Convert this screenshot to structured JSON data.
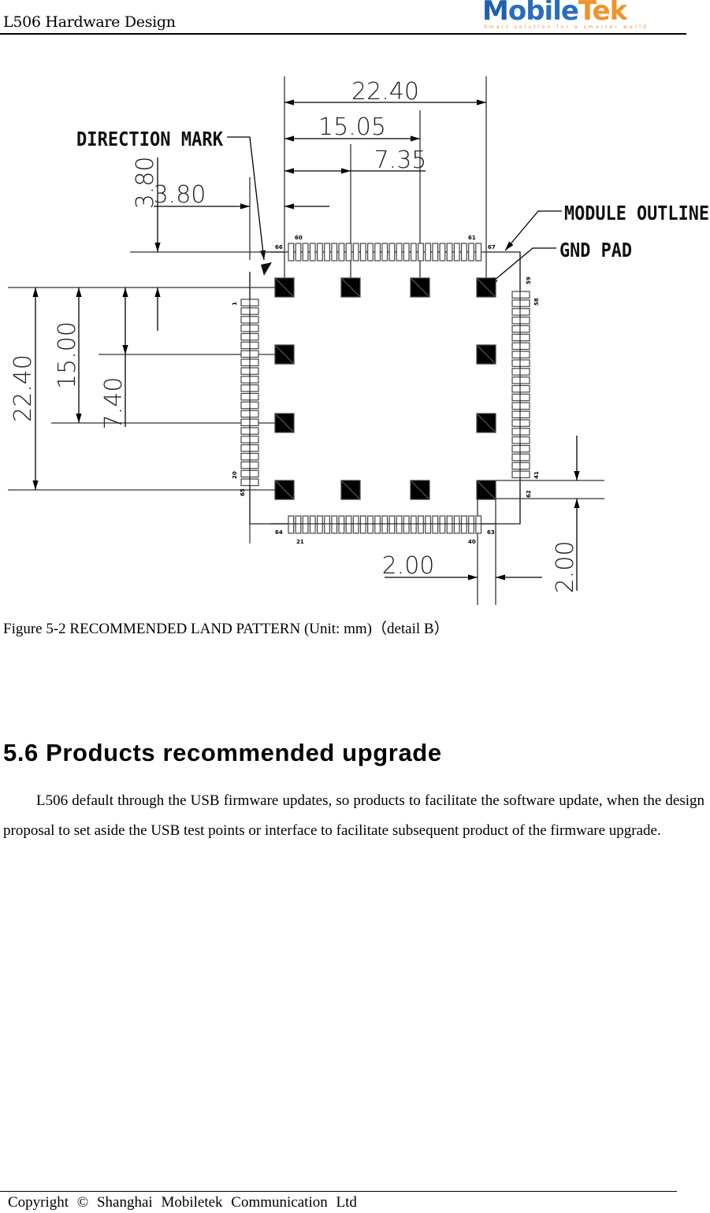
{
  "header": {
    "doc_title": "L506 Hardware Design",
    "logo": {
      "brand_prefix": "M",
      "brand_mid": "obile",
      "brand_suffix": "Tek",
      "tagline": "Smart solution for a smarter world",
      "colors": {
        "blue": "#1f5fb0",
        "orange": "#f0922b"
      }
    }
  },
  "figure": {
    "labels": {
      "direction_mark": "DIRECTION MARK",
      "module_outline": "MODULE OUTLINE",
      "gnd_pad": "GND PAD"
    },
    "dimensions": {
      "top_width": "22.40",
      "top_15": "15.05",
      "top_7": "7.35",
      "mark_h": "3.80",
      "mark_v": "3.80",
      "left_height": "22.40",
      "left_15": "15.00",
      "left_7": "7.40",
      "bottom_gap_h": "2.00",
      "right_gap_v": "2.00"
    },
    "pin_labels": {
      "top_left": "66",
      "top_second": "60",
      "top_right_inner": "61",
      "top_right": "67",
      "left_top": "1",
      "left_bottom": "20",
      "left_corner": "65",
      "bottom_left": "64",
      "bottom_first": "21",
      "bottom_last": "40",
      "bottom_right": "63",
      "right_top": "59",
      "right_second": "58",
      "right_bottom": "41",
      "right_corner": "62"
    },
    "pad_counts": {
      "top_row": 27,
      "bottom_row": 27,
      "left_column": 22,
      "right_column": 22,
      "gnd_pads": 12
    },
    "caption": "Figure 5-2 RECOMMENDED LAND PATTERN (Unit: mm)（detail B）"
  },
  "section": {
    "title": "5.6 Products recommended upgrade",
    "paragraph": "L506 default through the USB firmware updates, so products to facilitate the software update, when the design proposal to set aside the USB test points or interface to facilitate subsequent product of the firmware upgrade."
  },
  "footer": {
    "copyright": "Copyright © Shanghai Mobiletek Communication Ltd"
  }
}
